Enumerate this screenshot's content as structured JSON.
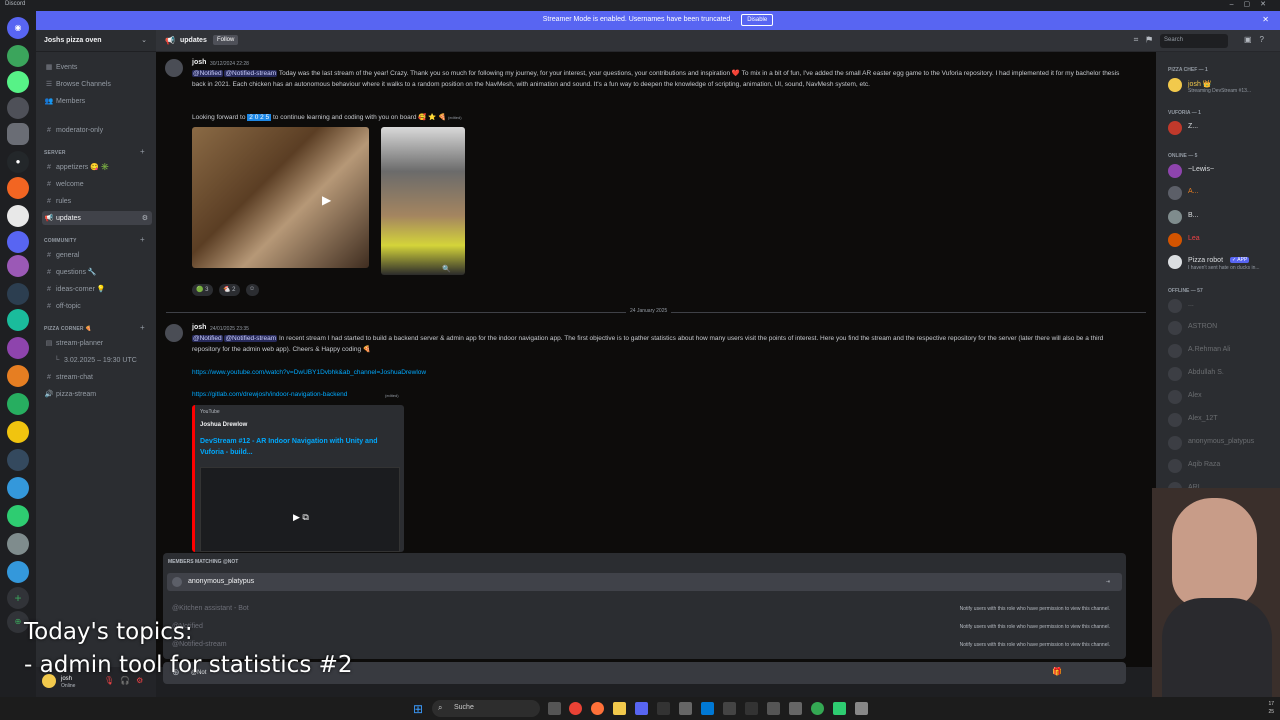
{
  "window": {
    "app_name": "Discord"
  },
  "banner": {
    "text": "Streamer Mode is enabled. Usernames have been truncated.",
    "button": "Disable"
  },
  "guild": {
    "name": "Joshs pizza oven"
  },
  "sidebar": {
    "top_items": [
      {
        "label": "Events",
        "icon": "calendar-icon"
      },
      {
        "label": "Browse Channels",
        "icon": "browse-icon"
      },
      {
        "label": "Members",
        "icon": "members-icon"
      }
    ],
    "moderator": "moderator-only",
    "categories": [
      {
        "name": "SERVER",
        "channels": [
          "appetizers 😋 ✳️",
          "welcome",
          "rules",
          "updates"
        ]
      },
      {
        "name": "COMMUNITY",
        "channels": [
          "general",
          "questions 🔧",
          "ideas-corner 💡",
          "off-topic"
        ]
      },
      {
        "name": "PIZZA CORNER 🍕",
        "channels": [
          "stream-planner",
          "3.02.2025 – 19:30 UTC",
          "stream-chat",
          "pizza-stream"
        ]
      }
    ],
    "active_channel": "updates"
  },
  "channel_header": {
    "name": "updates",
    "follow": "Follow",
    "search_placeholder": "Search"
  },
  "messages": [
    {
      "author": "josh",
      "timestamp": "30/12/2024 22:28",
      "mention1": "@Notified",
      "mention2": "@Notified-stream",
      "text": "Today was the last stream of the year! Crazy. Thank you so much for following my journey, for your interest, your questions, your contributions and inspiration ❤️ To mix in a bit of fun, I've added the small AR easter egg game to the Vuforia repository. I had implemented it for my bachelor thesis back in 2021. Each chicken has an autonomous behaviour where it walks to a random position on the NavMesh, with animation and sound. It's a fun way to deepen the knowledge of scripting, animation, UI, sound, NavMesh system, etc.",
      "text2_pre": "Looking forward to",
      "year": "2 0 2 5",
      "text2_post": "to continue learning and coding with you on board 🥰 ⭐ 🍕",
      "edited": "(edited)",
      "reactions": [
        {
          "emoji": "🟢",
          "count": "3"
        },
        {
          "emoji": "🐔",
          "count": "2"
        }
      ]
    },
    {
      "author": "josh",
      "timestamp": "24/01/2025 23:35",
      "mention1": "@Notified",
      "mention2": "@Notified-stream",
      "text": "In recent stream I had started to build a backend server & admin app for the indoor navigation app. The first objective is to gather statistics about how many users visit the points of interest. Here you find the stream and the respective repository for the server (later there will also be a third repository for the admin web app). Cheers & Happy coding 🍕",
      "link1": "https://www.youtube.com/watch?v=DwUBY1Dvbhk&ab_channel=JoshuaDrewlow",
      "link2": "https://gitlab.com/drewjosh/indoor-navigation-backend",
      "edited": "(edited)",
      "embed": {
        "provider": "YouTube",
        "author": "Joshua Drewlow",
        "title": "DevStream #12 - AR Indoor Navigation with Unity and Vuforia - build..."
      }
    }
  ],
  "date_divider": "24 January 2025",
  "autocomplete": {
    "title": "MEMBERS MATCHING @NOT",
    "rows": [
      {
        "name": "anonymous_platypus",
        "desc": ""
      },
      {
        "name": "@Kitchen assistant - Bot",
        "desc": "Notify users with this role who have permission to view this channel."
      },
      {
        "name": "@Notified",
        "desc": "Notify users with this role who have permission to view this channel."
      },
      {
        "name": "@Notified-stream",
        "desc": "Notify users with this role who have permission to view this channel."
      }
    ]
  },
  "composer": {
    "value": "@Not"
  },
  "members": {
    "groups": [
      {
        "title": "PIZZA CHEF — 1",
        "members": [
          {
            "name": "josh 👑",
            "sub": "Streaming DevStream #13..."
          }
        ]
      },
      {
        "title": "VUFORIA — 1",
        "members": [
          {
            "name": "Z...",
            "sub": ""
          }
        ]
      },
      {
        "title": "ONLINE — 5",
        "members": [
          {
            "name": "~Lewis~",
            "sub": ""
          },
          {
            "name": "A...",
            "sub": ""
          },
          {
            "name": "B...",
            "sub": ""
          },
          {
            "name": "Lea",
            "sub": ""
          },
          {
            "name": "Pizza robot",
            "sub": "I haven't sent hate on ducks in..."
          }
        ]
      },
      {
        "title": "OFFLINE — 57",
        "members": [
          {
            "name": "...",
            "sub": ""
          },
          {
            "name": "ASTRON",
            "sub": ""
          },
          {
            "name": "A.Rehman Ali",
            "sub": ""
          },
          {
            "name": "Abdullah S.",
            "sub": ""
          },
          {
            "name": "Alex",
            "sub": ""
          },
          {
            "name": "Alex_12T",
            "sub": ""
          },
          {
            "name": "anonymous_platypus",
            "sub": ""
          },
          {
            "name": "Aqib Raza",
            "sub": ""
          },
          {
            "name": "ARI...",
            "sub": ""
          }
        ]
      }
    ],
    "bot_tag": "✓ APP"
  },
  "user_panel": {
    "name": "josh",
    "status": "Online"
  },
  "overlay": {
    "line1": "Today's topics:",
    "line2": "- admin tool for statistics #2"
  },
  "taskbar": {
    "search": "Suche",
    "clock1": "17",
    "clock2": "25"
  }
}
